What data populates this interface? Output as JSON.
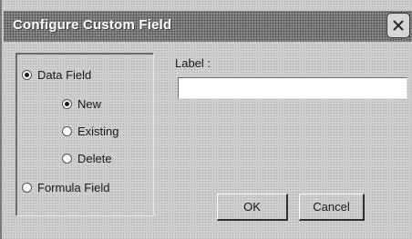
{
  "window": {
    "title": "Configure Custom Field"
  },
  "field_type_group": {
    "data_field_label": "Data Field",
    "new_label": "New",
    "existing_label": "Existing",
    "delete_label": "Delete",
    "formula_field_label": "Formula Field",
    "selected_type": "Data Field",
    "selected_action": "New"
  },
  "label_field": {
    "caption": "Label :",
    "value": ""
  },
  "buttons": {
    "ok_label": "OK",
    "cancel_label": "Cancel"
  },
  "icons": {
    "close": "close-icon"
  }
}
